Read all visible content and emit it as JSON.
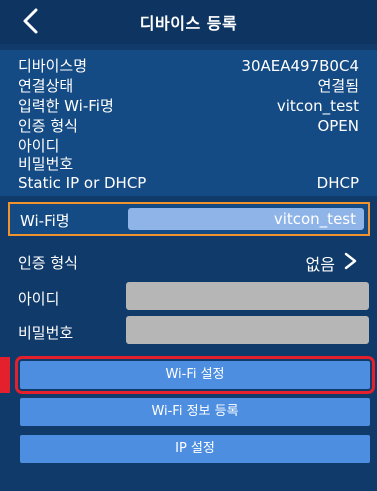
{
  "header": {
    "title": "디바이스 등록"
  },
  "device_info": [
    {
      "label": "디바이스명",
      "value": "30AEA497B0C4"
    },
    {
      "label": "연결상태",
      "value": "연결됨"
    },
    {
      "label": "입력한 Wi-Fi명",
      "value": "vitcon_test"
    },
    {
      "label": "인증 형식",
      "value": "OPEN"
    },
    {
      "label": "아이디",
      "value": ""
    },
    {
      "label": "비밀번호",
      "value": ""
    },
    {
      "label": "Static IP or DHCP",
      "value": "DHCP"
    }
  ],
  "form": {
    "wifi_name_label": "Wi-Fi명",
    "wifi_name_value": "vitcon_test",
    "auth_label": "인증 형식",
    "auth_value": "없음",
    "id_label": "아이디",
    "password_label": "비밀번호"
  },
  "buttons": {
    "wifi_setting": "Wi-Fi 설정",
    "wifi_register": "Wi-Fi 정보 등록",
    "ip_setting": "IP 설정"
  },
  "colors": {
    "background": "#0f3a6a",
    "panel": "#154b85",
    "button": "#4e8ee0",
    "highlight_orange": "#f0922e",
    "highlight_red": "#e3202b"
  }
}
